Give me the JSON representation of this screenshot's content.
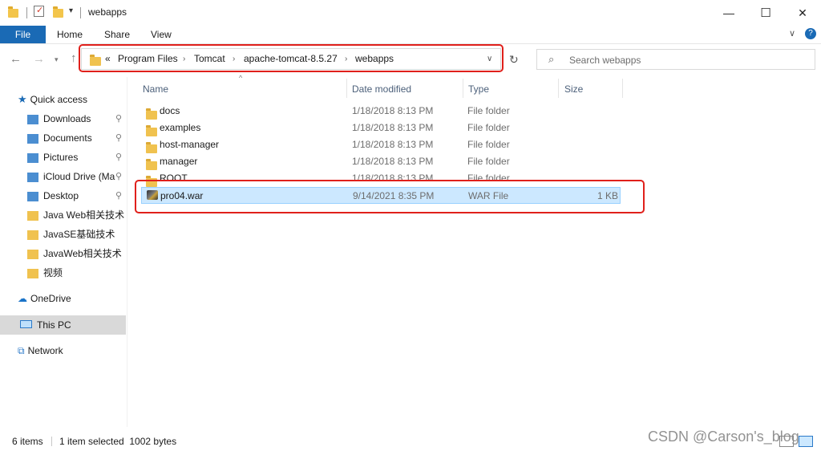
{
  "window": {
    "title": "webapps",
    "minimize_glyph": "—",
    "maximize_glyph": "☐",
    "close_glyph": "✕"
  },
  "ribbon": {
    "tabs": [
      "File",
      "Home",
      "Share",
      "View"
    ],
    "collapse_glyph": "∨",
    "help_glyph": "?"
  },
  "address": {
    "overflow_glyph": "«",
    "crumbs": [
      "Program Files",
      "Tomcat",
      "apache-tomcat-8.5.27",
      "webapps"
    ],
    "refresh_glyph": "↻"
  },
  "search": {
    "placeholder": "Search webapps"
  },
  "sidebar": {
    "quick_access": "Quick access",
    "items": [
      {
        "label": "Downloads",
        "icon": "downloads-icon",
        "pinned": true
      },
      {
        "label": "Documents",
        "icon": "documents-icon",
        "pinned": true
      },
      {
        "label": "Pictures",
        "icon": "pictures-icon",
        "pinned": true
      },
      {
        "label": "iCloud Drive (Ma",
        "icon": "icloud-icon",
        "pinned": true
      },
      {
        "label": "Desktop",
        "icon": "desktop-icon",
        "pinned": true
      },
      {
        "label": "Java Web相关技术",
        "icon": "folder-icon",
        "pinned": false
      },
      {
        "label": "JavaSE基础技术",
        "icon": "folder-icon",
        "pinned": false
      },
      {
        "label": "JavaWeb相关技术",
        "icon": "folder-icon",
        "pinned": false
      },
      {
        "label": "视频",
        "icon": "folder-icon",
        "pinned": false
      }
    ],
    "onedrive": "OneDrive",
    "this_pc": "This PC",
    "network": "Network"
  },
  "columns": {
    "name": "Name",
    "date": "Date modified",
    "type": "Type",
    "size": "Size"
  },
  "files": [
    {
      "name": "docs",
      "date": "1/18/2018 8:13 PM",
      "type": "File folder",
      "size": ""
    },
    {
      "name": "examples",
      "date": "1/18/2018 8:13 PM",
      "type": "File folder",
      "size": ""
    },
    {
      "name": "host-manager",
      "date": "1/18/2018 8:13 PM",
      "type": "File folder",
      "size": ""
    },
    {
      "name": "manager",
      "date": "1/18/2018 8:13 PM",
      "type": "File folder",
      "size": ""
    },
    {
      "name": "ROOT",
      "date": "1/18/2018 8:13 PM",
      "type": "File folder",
      "size": ""
    },
    {
      "name": "pro04.war",
      "date": "9/14/2021 8:35 PM",
      "type": "WAR File",
      "size": "1 KB"
    }
  ],
  "status": {
    "count": "6 items",
    "selection": "1 item selected  1002 bytes"
  },
  "watermark": "CSDN @Carson's_blog",
  "colors": {
    "accent": "#1a6ab5",
    "selection": "#cce8ff",
    "highlight_box": "#e0201b"
  }
}
